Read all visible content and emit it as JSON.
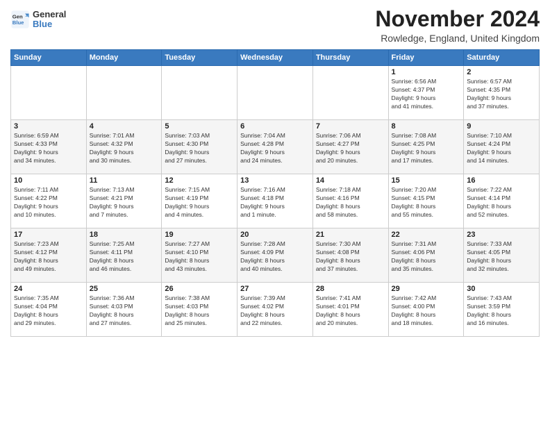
{
  "logo": {
    "general": "General",
    "blue": "Blue"
  },
  "title": "November 2024",
  "subtitle": "Rowledge, England, United Kingdom",
  "days_of_week": [
    "Sunday",
    "Monday",
    "Tuesday",
    "Wednesday",
    "Thursday",
    "Friday",
    "Saturday"
  ],
  "weeks": [
    [
      {
        "day": "",
        "info": ""
      },
      {
        "day": "",
        "info": ""
      },
      {
        "day": "",
        "info": ""
      },
      {
        "day": "",
        "info": ""
      },
      {
        "day": "",
        "info": ""
      },
      {
        "day": "1",
        "info": "Sunrise: 6:56 AM\nSunset: 4:37 PM\nDaylight: 9 hours\nand 41 minutes."
      },
      {
        "day": "2",
        "info": "Sunrise: 6:57 AM\nSunset: 4:35 PM\nDaylight: 9 hours\nand 37 minutes."
      }
    ],
    [
      {
        "day": "3",
        "info": "Sunrise: 6:59 AM\nSunset: 4:33 PM\nDaylight: 9 hours\nand 34 minutes."
      },
      {
        "day": "4",
        "info": "Sunrise: 7:01 AM\nSunset: 4:32 PM\nDaylight: 9 hours\nand 30 minutes."
      },
      {
        "day": "5",
        "info": "Sunrise: 7:03 AM\nSunset: 4:30 PM\nDaylight: 9 hours\nand 27 minutes."
      },
      {
        "day": "6",
        "info": "Sunrise: 7:04 AM\nSunset: 4:28 PM\nDaylight: 9 hours\nand 24 minutes."
      },
      {
        "day": "7",
        "info": "Sunrise: 7:06 AM\nSunset: 4:27 PM\nDaylight: 9 hours\nand 20 minutes."
      },
      {
        "day": "8",
        "info": "Sunrise: 7:08 AM\nSunset: 4:25 PM\nDaylight: 9 hours\nand 17 minutes."
      },
      {
        "day": "9",
        "info": "Sunrise: 7:10 AM\nSunset: 4:24 PM\nDaylight: 9 hours\nand 14 minutes."
      }
    ],
    [
      {
        "day": "10",
        "info": "Sunrise: 7:11 AM\nSunset: 4:22 PM\nDaylight: 9 hours\nand 10 minutes."
      },
      {
        "day": "11",
        "info": "Sunrise: 7:13 AM\nSunset: 4:21 PM\nDaylight: 9 hours\nand 7 minutes."
      },
      {
        "day": "12",
        "info": "Sunrise: 7:15 AM\nSunset: 4:19 PM\nDaylight: 9 hours\nand 4 minutes."
      },
      {
        "day": "13",
        "info": "Sunrise: 7:16 AM\nSunset: 4:18 PM\nDaylight: 9 hours\nand 1 minute."
      },
      {
        "day": "14",
        "info": "Sunrise: 7:18 AM\nSunset: 4:16 PM\nDaylight: 8 hours\nand 58 minutes."
      },
      {
        "day": "15",
        "info": "Sunrise: 7:20 AM\nSunset: 4:15 PM\nDaylight: 8 hours\nand 55 minutes."
      },
      {
        "day": "16",
        "info": "Sunrise: 7:22 AM\nSunset: 4:14 PM\nDaylight: 8 hours\nand 52 minutes."
      }
    ],
    [
      {
        "day": "17",
        "info": "Sunrise: 7:23 AM\nSunset: 4:12 PM\nDaylight: 8 hours\nand 49 minutes."
      },
      {
        "day": "18",
        "info": "Sunrise: 7:25 AM\nSunset: 4:11 PM\nDaylight: 8 hours\nand 46 minutes."
      },
      {
        "day": "19",
        "info": "Sunrise: 7:27 AM\nSunset: 4:10 PM\nDaylight: 8 hours\nand 43 minutes."
      },
      {
        "day": "20",
        "info": "Sunrise: 7:28 AM\nSunset: 4:09 PM\nDaylight: 8 hours\nand 40 minutes."
      },
      {
        "day": "21",
        "info": "Sunrise: 7:30 AM\nSunset: 4:08 PM\nDaylight: 8 hours\nand 37 minutes."
      },
      {
        "day": "22",
        "info": "Sunrise: 7:31 AM\nSunset: 4:06 PM\nDaylight: 8 hours\nand 35 minutes."
      },
      {
        "day": "23",
        "info": "Sunrise: 7:33 AM\nSunset: 4:05 PM\nDaylight: 8 hours\nand 32 minutes."
      }
    ],
    [
      {
        "day": "24",
        "info": "Sunrise: 7:35 AM\nSunset: 4:04 PM\nDaylight: 8 hours\nand 29 minutes."
      },
      {
        "day": "25",
        "info": "Sunrise: 7:36 AM\nSunset: 4:03 PM\nDaylight: 8 hours\nand 27 minutes."
      },
      {
        "day": "26",
        "info": "Sunrise: 7:38 AM\nSunset: 4:03 PM\nDaylight: 8 hours\nand 25 minutes."
      },
      {
        "day": "27",
        "info": "Sunrise: 7:39 AM\nSunset: 4:02 PM\nDaylight: 8 hours\nand 22 minutes."
      },
      {
        "day": "28",
        "info": "Sunrise: 7:41 AM\nSunset: 4:01 PM\nDaylight: 8 hours\nand 20 minutes."
      },
      {
        "day": "29",
        "info": "Sunrise: 7:42 AM\nSunset: 4:00 PM\nDaylight: 8 hours\nand 18 minutes."
      },
      {
        "day": "30",
        "info": "Sunrise: 7:43 AM\nSunset: 3:59 PM\nDaylight: 8 hours\nand 16 minutes."
      }
    ]
  ]
}
